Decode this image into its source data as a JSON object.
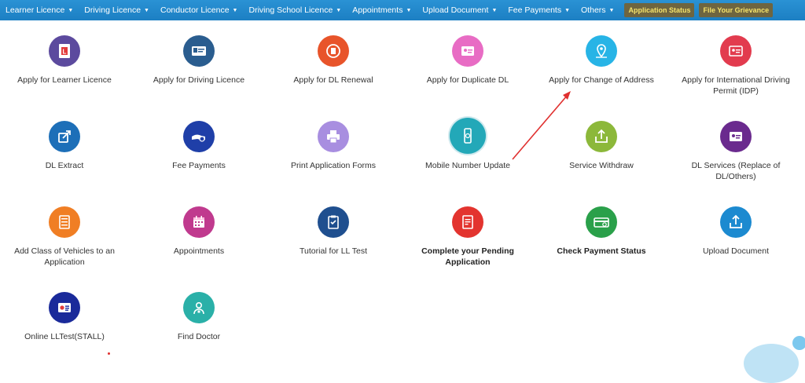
{
  "nav": {
    "items": [
      {
        "label": "Learner Licence",
        "caret": "▼"
      },
      {
        "label": "Driving Licence",
        "caret": "▼"
      },
      {
        "label": "Conductor Licence",
        "caret": "▼"
      },
      {
        "label": "Driving School Licence",
        "caret": "▼"
      },
      {
        "label": "Appointments",
        "caret": "▼"
      },
      {
        "label": "Upload Document",
        "caret": "▼"
      },
      {
        "label": "Fee Payments",
        "caret": "▼"
      },
      {
        "label": "Others",
        "caret": "▼"
      }
    ],
    "buttons": [
      {
        "label": "Application Status"
      },
      {
        "label": "File Your Grievance"
      }
    ]
  },
  "tiles": [
    {
      "label": "Apply for Learner Licence",
      "color": "#5c4a9e",
      "icon": "learner-licence-icon"
    },
    {
      "label": "Apply for Driving Licence",
      "color": "#2a5d8f",
      "icon": "driving-licence-card-icon"
    },
    {
      "label": "Apply for DL Renewal",
      "color": "#e8542a",
      "icon": "dl-renewal-icon"
    },
    {
      "label": "Apply for Duplicate DL",
      "color": "#e86cc4",
      "icon": "duplicate-dl-icon"
    },
    {
      "label": "Apply for Change of Address",
      "color": "#27b4e6",
      "icon": "location-pin-icon"
    },
    {
      "label": "Apply for International Driving Permit (IDP)",
      "color": "#e23b4e",
      "icon": "idp-card-icon"
    },
    {
      "label": "DL Extract",
      "color": "#1d6fb8",
      "icon": "share-export-icon"
    },
    {
      "label": "Fee Payments",
      "color": "#1f3fa8",
      "icon": "payment-hand-icon"
    },
    {
      "label": "Print Application Forms",
      "color": "#a88ee0",
      "icon": "printer-icon"
    },
    {
      "label": "Mobile Number Update",
      "color": "#23a8b8",
      "icon": "mobile-phone-icon"
    },
    {
      "label": "Service Withdraw",
      "color": "#8cb83a",
      "icon": "withdraw-upload-icon"
    },
    {
      "label": "DL Services (Replace of DL/Others)",
      "color": "#6a2a8e",
      "icon": "dl-services-card-icon"
    },
    {
      "label": "Add Class of Vehicles to an Application",
      "color": "#f07e24",
      "icon": "checklist-icon"
    },
    {
      "label": "Appointments",
      "color": "#c03a8e",
      "icon": "calendar-icon"
    },
    {
      "label": "Tutorial for LL Test",
      "color": "#1f4f8f",
      "icon": "clipboard-check-icon"
    },
    {
      "label": "Complete your Pending Application",
      "color": "#e3342f",
      "icon": "pending-document-icon",
      "bold": true
    },
    {
      "label": "Check Payment Status",
      "color": "#2aa04a",
      "icon": "payment-card-icon",
      "bold": true
    },
    {
      "label": "Upload Document",
      "color": "#1c8ad0",
      "icon": "upload-tray-icon"
    },
    {
      "label": "Online LLTest(STALL)",
      "color": "#1a2a9a",
      "icon": "online-test-icon"
    },
    {
      "label": "Find Doctor",
      "color": "#2ab0a8",
      "icon": "doctor-icon"
    }
  ]
}
